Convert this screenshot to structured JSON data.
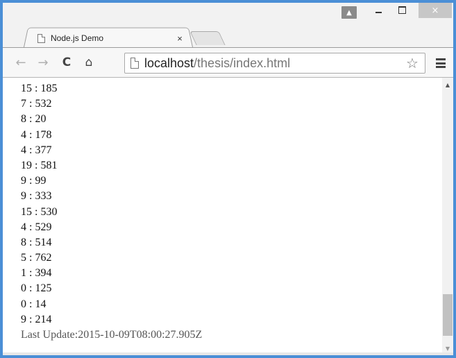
{
  "window": {
    "user_icon": "person-icon",
    "minimize": "minimize-icon",
    "maximize": "maximize-icon",
    "close": "×"
  },
  "tab": {
    "title": "Node.js Demo",
    "close": "×"
  },
  "toolbar": {
    "back": "←",
    "forward": "→",
    "reload": "C",
    "home": "⌂",
    "url_host": "localhost",
    "url_path": "/thesis/index.html",
    "star": "☆"
  },
  "content": {
    "lines": [
      "15 : 185",
      "7 : 532",
      "8 : 20",
      "4 : 178",
      "4 : 377",
      "19 : 581",
      "9 : 99",
      "9 : 333",
      "15 : 530",
      "4 : 529",
      "8 : 514",
      "5 : 762",
      "1 : 394",
      "0 : 125",
      "0 : 14",
      "9 : 214"
    ],
    "last_update_label": "Last Update:",
    "last_update_value": "2015-10-09T08:00:27.905Z"
  },
  "colors": {
    "frame": "#4b8fd6",
    "chrome": "#f2f2f2"
  }
}
